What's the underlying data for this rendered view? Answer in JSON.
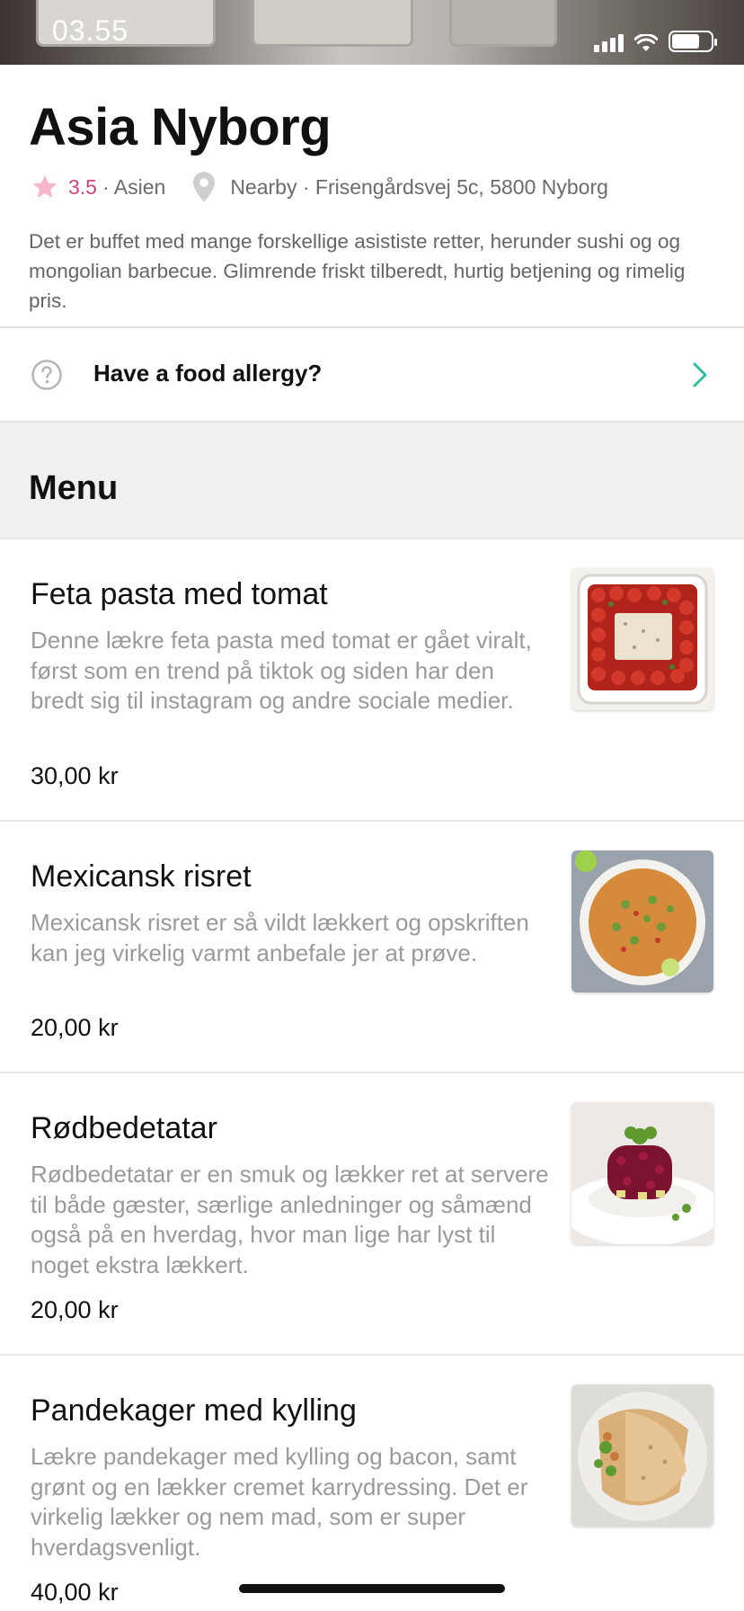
{
  "status_bar": {
    "time": "03.55"
  },
  "restaurant": {
    "name": "Asia Nyborg",
    "rating": "3.5",
    "cuisine": "· Asien",
    "location": "Nearby · Frisengårdsvej 5c, 5800 Nyborg",
    "description": "Det er buffet med mange forskellige asististe retter, herunder sushi og og mongolian barbecue. Glimrende friskt tilberedt, hurtig betjening og rimelig pris."
  },
  "allergy": {
    "label": "Have a food allergy?"
  },
  "menu": {
    "title": "Menu",
    "items": [
      {
        "name": "Feta pasta med tomat",
        "description": "Denne lækre feta pasta med tomat er gået viralt, først som en trend på tiktok og siden har den bredt sig til instagram og andre sociale medier.",
        "price": "30,00 kr"
      },
      {
        "name": "Mexicansk risret",
        "description": "Mexicansk risret er så vildt lækkert og opskriften kan jeg virkelig varmt anbefale jer at prøve.",
        "price": "20,00 kr"
      },
      {
        "name": "Rødbedetatar",
        "description": "Rødbedetatar er en smuk og lækker ret at servere til både gæster, særlige anledninger og såmænd også på en hverdag, hvor man lige har lyst til noget ekstra lækkert.",
        "price": "20,00 kr"
      },
      {
        "name": "Pandekager med kylling",
        "description": "Lækre pandekager med kylling og bacon, samt grønt og en lækker cremet karrydressing. Det er virkelig lækker og nem mad, som er super hverdagsvenligt.",
        "price": "40,00 kr"
      }
    ]
  },
  "colors": {
    "accent_teal": "#2bbfa4",
    "rating_pink": "#d0457a",
    "star_pink": "#f7b6cb"
  }
}
